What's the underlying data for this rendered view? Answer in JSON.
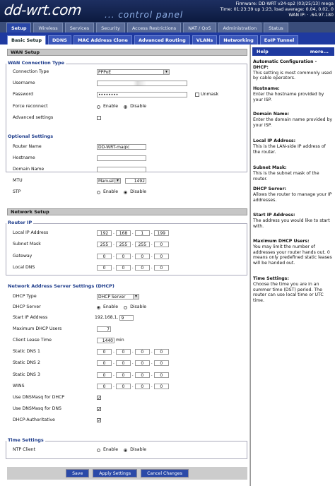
{
  "header": {
    "logo": "dd-wrt.com",
    "panel": "... control panel",
    "firmware": "Firmware: DD-WRT v24-sp2 (03/25/13) mega",
    "time": "Time: 01:23:39 up 1:23, load average: 0.04, 0.02, 0",
    "wan_ip": "WAN IP: ·  .64.97.180"
  },
  "tabs1": [
    "Setup",
    "Wireless",
    "Services",
    "Security",
    "Access Restrictions",
    "NAT / QoS",
    "Administration",
    "Status"
  ],
  "tabs2": [
    "Basic Setup",
    "DDNS",
    "MAC Address Clone",
    "Advanced Routing",
    "VLANs",
    "Networking",
    "EoIP Tunnel"
  ],
  "wan": {
    "section": "WAN Setup",
    "legend": "WAN Connection Type",
    "conn_label": "Connection Type",
    "conn_value": "PPPoE",
    "user_label": "Username",
    "user_value": "",
    "pass_label": "Password",
    "pass_value": "••••••••",
    "unmask": "Unmask",
    "force_label": "Force reconnect",
    "enable": "Enable",
    "disable": "Disable",
    "adv_label": "Advanced settings"
  },
  "optional": {
    "legend": "Optional Settings",
    "router_name_label": "Router Name",
    "router_name": "DD-WRT-magic",
    "hostname_label": "Hostname",
    "domain_label": "Domain Name",
    "mtu_label": "MTU",
    "mtu_mode": "Manual",
    "mtu_value": "1492",
    "stp_label": "STP",
    "enable": "Enable",
    "disable": "Disable"
  },
  "network": {
    "section": "Network Setup",
    "legend": "Router IP",
    "lip_label": "Local IP Address",
    "lip": [
      "192",
      "168",
      "1",
      "199"
    ],
    "mask_label": "Subnet Mask",
    "mask": [
      "255",
      "255",
      "255",
      "0"
    ],
    "gw_label": "Gateway",
    "gw": [
      "0",
      "0",
      "0",
      "0"
    ],
    "dns_label": "Local DNS",
    "dns": [
      "0",
      "0",
      "0",
      "0"
    ]
  },
  "dhcp": {
    "legend": "Network Address Server Settings (DHCP)",
    "type_label": "DHCP Type",
    "type_value": "DHCP Server",
    "server_label": "DHCP Server",
    "enable": "Enable",
    "disable": "Disable",
    "start_label": "Start IP Address",
    "start_prefix": "192.168.1.",
    "start_value": "9",
    "max_label": "Maximum DHCP Users",
    "max_value": "7",
    "lease_label": "Client Lease Time",
    "lease_value": "1440",
    "lease_unit": "min",
    "dns1_label": "Static DNS 1",
    "dns2_label": "Static DNS 2",
    "dns3_label": "Static DNS 3",
    "wins_label": "WINS",
    "zero": "0",
    "dnsmasq_dhcp_label": "Use DNSMasq for DHCP",
    "dnsmasq_dns_label": "Use DNSMasq for DNS",
    "auth_label": "DHCP-Authoritative",
    "check": "✓"
  },
  "time": {
    "legend": "Time Settings",
    "ntp_label": "NTP Client",
    "enable": "Enable",
    "disable": "Disable"
  },
  "buttons": {
    "save": "Save",
    "apply": "Apply Settings",
    "cancel": "Cancel Changes"
  },
  "help": {
    "title": "Help",
    "more": "more...",
    "items": [
      {
        "t": "Automatic Configuration - DHCP:",
        "d": "This setting is most commonly used by cable operators."
      },
      {
        "t": "Hostname:",
        "d": "Enter the hostname provided by your ISP."
      },
      {
        "t": "Domain Name:",
        "d": "Enter the domain name provided by your ISP."
      },
      {
        "t": "Local IP Address:",
        "d": "This is the LAN-side IP address of the router."
      },
      {
        "t": "Subnet Mask:",
        "d": "This is the subnet mask of the router."
      },
      {
        "t": "DHCP Server:",
        "d": "Allows the router to manage your IP addresses."
      },
      {
        "t": "Start IP Address:",
        "d": "The address you would like to start with."
      },
      {
        "t": "Maximum DHCP Users:",
        "d": "You may limit the number of addresses your router hands out. 0 means only predefined static leases will be handed out."
      },
      {
        "t": "Time Settings:",
        "d": "Choose the time you are in an summer time (DST) period. The router can use local time or UTC time."
      }
    ]
  }
}
